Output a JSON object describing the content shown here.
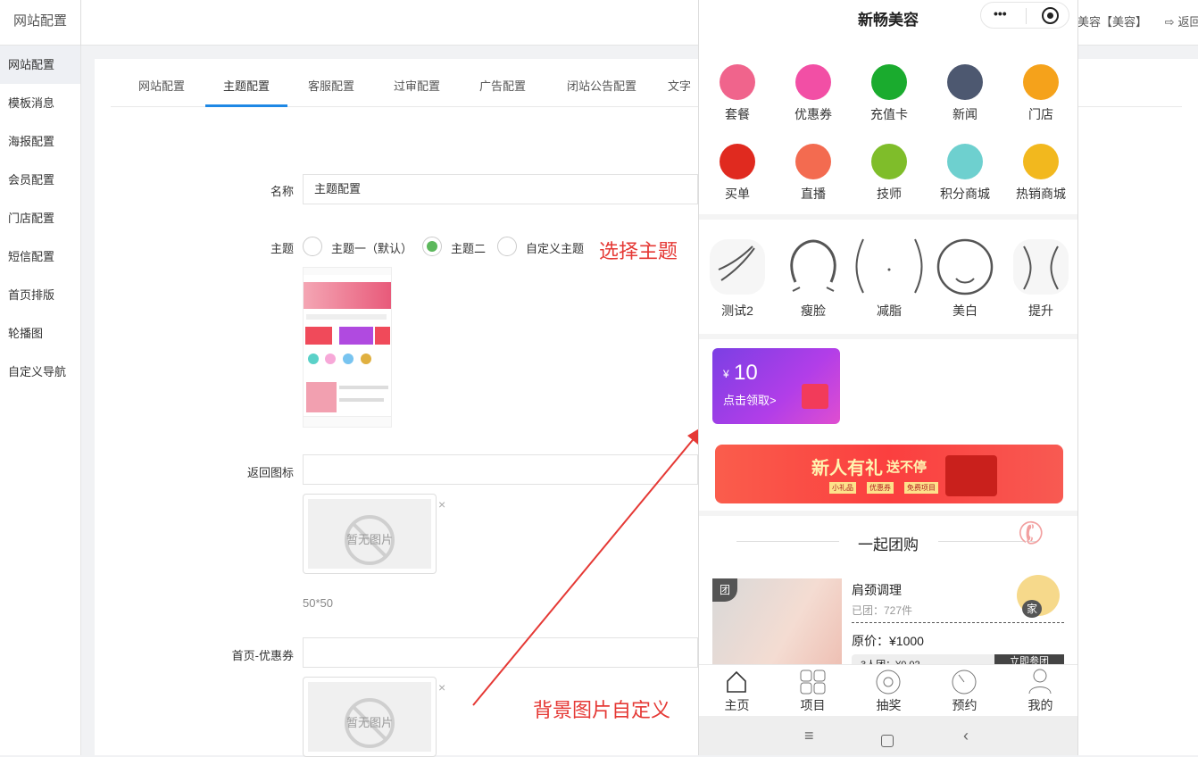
{
  "topbar": {
    "brand": "网站配置",
    "right_store": "美容【美容】",
    "right_back": "返回"
  },
  "sidebar": {
    "items": [
      "网站配置",
      "模板消息",
      "海报配置",
      "会员配置",
      "门店配置",
      "短信配置",
      "首页排版",
      "轮播图",
      "自定义导航"
    ]
  },
  "tabs": [
    "网站配置",
    "主题配置",
    "客服配置",
    "过审配置",
    "广告配置",
    "闭站公告配置",
    "文字"
  ],
  "form": {
    "name_label": "名称",
    "name_value": "主题配置",
    "theme_label": "主题",
    "theme_options": [
      "主题一（默认）",
      "主题二",
      "自定义主题"
    ],
    "back_icon_label": "返回图标",
    "no_image": "暂无图片",
    "size_hint": "50*50",
    "coupon_label": "首页-优惠券",
    "remove": "×"
  },
  "annotations": {
    "choose_theme": "选择主题",
    "bg_custom": "背景图片自定义"
  },
  "phone": {
    "title": "新畅美容",
    "capsule_more": "•••",
    "grid": [
      {
        "label": "套餐",
        "color": "#f0648c"
      },
      {
        "label": "优惠券",
        "color": "#f24fa5"
      },
      {
        "label": "充值卡",
        "color": "#1aab2e"
      },
      {
        "label": "新闻",
        "color": "#4d5870"
      },
      {
        "label": "门店",
        "color": "#f5a21b"
      },
      {
        "label": "买单",
        "color": "#e02a1f"
      },
      {
        "label": "直播",
        "color": "#f36b50"
      },
      {
        "label": "技师",
        "color": "#7fbd2a"
      },
      {
        "label": "积分商城",
        "color": "#6ed0cf"
      },
      {
        "label": "热销商城",
        "color": "#f2b81e"
      }
    ],
    "features": [
      "测试2",
      "瘦脸",
      "减脂",
      "美白",
      "提升"
    ],
    "coupon": {
      "currency": "¥",
      "amount": "10",
      "action": "点击领取>"
    },
    "banner": {
      "title": "新人有礼",
      "sub": "送不停",
      "tags": [
        "小礼品",
        "优惠券",
        "免费项目"
      ]
    },
    "group_title": "一起团购",
    "product": {
      "badge": "团",
      "name": "肩颈调理",
      "sold": "已团：727件",
      "price": "原价：¥1000",
      "partial": "3人团：¥0.02",
      "buy": "立即参团",
      "home": "家"
    },
    "tabbar": [
      "主页",
      "项目",
      "抽奖",
      "预约",
      "我的"
    ]
  }
}
